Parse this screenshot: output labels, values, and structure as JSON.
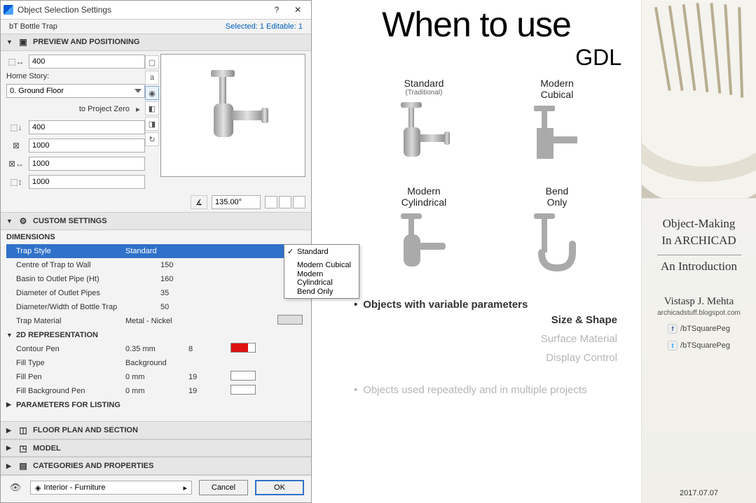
{
  "dialog": {
    "title": "Object Selection Settings",
    "status_left": "bT Bottle Trap",
    "status_right": "Selected: 1 Editable: 1",
    "sections": {
      "preview": {
        "title": "PREVIEW AND POSITIONING",
        "top_width": "400",
        "home_story_label": "Home Story:",
        "home_story": "0. Ground Floor",
        "to_proj_zero_label": "to Project Zero",
        "to_proj_zero": "400",
        "dim_x": "1000",
        "dim_y": "1000",
        "dim_z": "1000",
        "angle": "135.00°"
      },
      "custom": {
        "title": "CUSTOM SETTINGS",
        "group_dim": "DIMENSIONS",
        "group_2d": "2D REPRESENTATION",
        "group_listing": "PARAMETERS FOR LISTING",
        "rows": {
          "trap_style": {
            "name": "Trap Style",
            "value": "Standard"
          },
          "centre": {
            "name": "Centre of Trap to Wall",
            "value": "150"
          },
          "basin": {
            "name": "Basin to Outlet Pipe (Ht)",
            "value": "160"
          },
          "dia_out": {
            "name": "Diameter of Outlet Pipes",
            "value": "35"
          },
          "dia_width": {
            "name": "Diameter/Width of Bottle Trap",
            "value": "50"
          },
          "trap_mat": {
            "name": "Trap Material",
            "value": "Metal - Nickel"
          },
          "contour_pen": {
            "name": "Contour Pen",
            "v1": "0.35 mm",
            "v2": "8"
          },
          "fill_type": {
            "name": "Fill Type",
            "v1": "Background"
          },
          "fill_pen": {
            "name": "Fill Pen",
            "v1": "0 mm",
            "v2": "19"
          },
          "fill_bg_pen": {
            "name": "Fill Background Pen",
            "v1": "0 mm",
            "v2": "19"
          }
        }
      },
      "floorplan": {
        "title": "FLOOR PLAN AND SECTION"
      },
      "model": {
        "title": "MODEL"
      },
      "categories": {
        "title": "CATEGORIES AND PROPERTIES"
      }
    },
    "dropdown": {
      "selected": "Standard",
      "opts": [
        "Standard",
        "Modern Cubical",
        "Modern Cylindrical",
        "Bend Only"
      ]
    },
    "footer": {
      "classifier": "Interior - Furniture",
      "cancel": "Cancel",
      "ok": "OK"
    }
  },
  "slide": {
    "heading": "When to use",
    "subheading": "GDL",
    "variants": {
      "v1": {
        "label": "Standard",
        "sub": "(Traditional)"
      },
      "v2": {
        "label": "Modern\nCubical"
      },
      "v3": {
        "label": "Modern\nCylindrical"
      },
      "v4": {
        "label": "Bend\nOnly"
      }
    },
    "bullets": {
      "b1": "Objects with variable parameters",
      "b1a": "Size & Shape",
      "b1b": "Surface Material",
      "b1c": "Display Control",
      "b2": "Objects used repeatedly and in multiple projects"
    }
  },
  "sidebar": {
    "title1": "Object-Making",
    "title2": "In ARCHICAD",
    "title3": "An Introduction",
    "author": "Vistasp J. Mehta",
    "site": "archicadstuff.blogspot.com",
    "social_handle": "/bTSquarePeg",
    "date": "2017.07.07"
  }
}
